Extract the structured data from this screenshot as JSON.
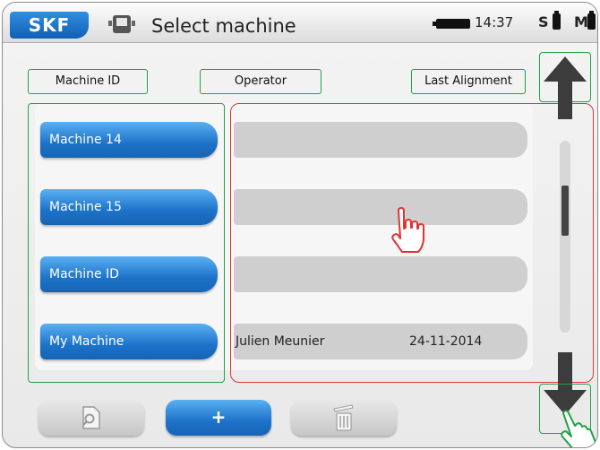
{
  "header": {
    "logo_text": "SKF",
    "title": "Select machine",
    "time": "14:37",
    "status_s": "S",
    "status_m": "M"
  },
  "columns": {
    "machine_id": "Machine ID",
    "operator": "Operator",
    "last_alignment": "Last Alignment"
  },
  "rows": [
    {
      "machine": "Machine 14",
      "operator": "",
      "date": ""
    },
    {
      "machine": "Machine 15",
      "operator": "",
      "date": ""
    },
    {
      "machine": "Machine ID",
      "operator": "",
      "date": ""
    },
    {
      "machine": "My Machine",
      "operator": "Julien Meunier",
      "date": "24-11-2014"
    }
  ],
  "toolbar": {
    "add_label": "+"
  },
  "colors": {
    "accent_blue": "#1d72c9",
    "highlight_green": "#22a24a",
    "highlight_red": "#e03434"
  },
  "icons": [
    "machine-icon",
    "scroll-up-arrow-icon",
    "scroll-down-arrow-icon",
    "hand-pointer-icon",
    "search-document-icon",
    "trash-icon",
    "battery-icon"
  ]
}
